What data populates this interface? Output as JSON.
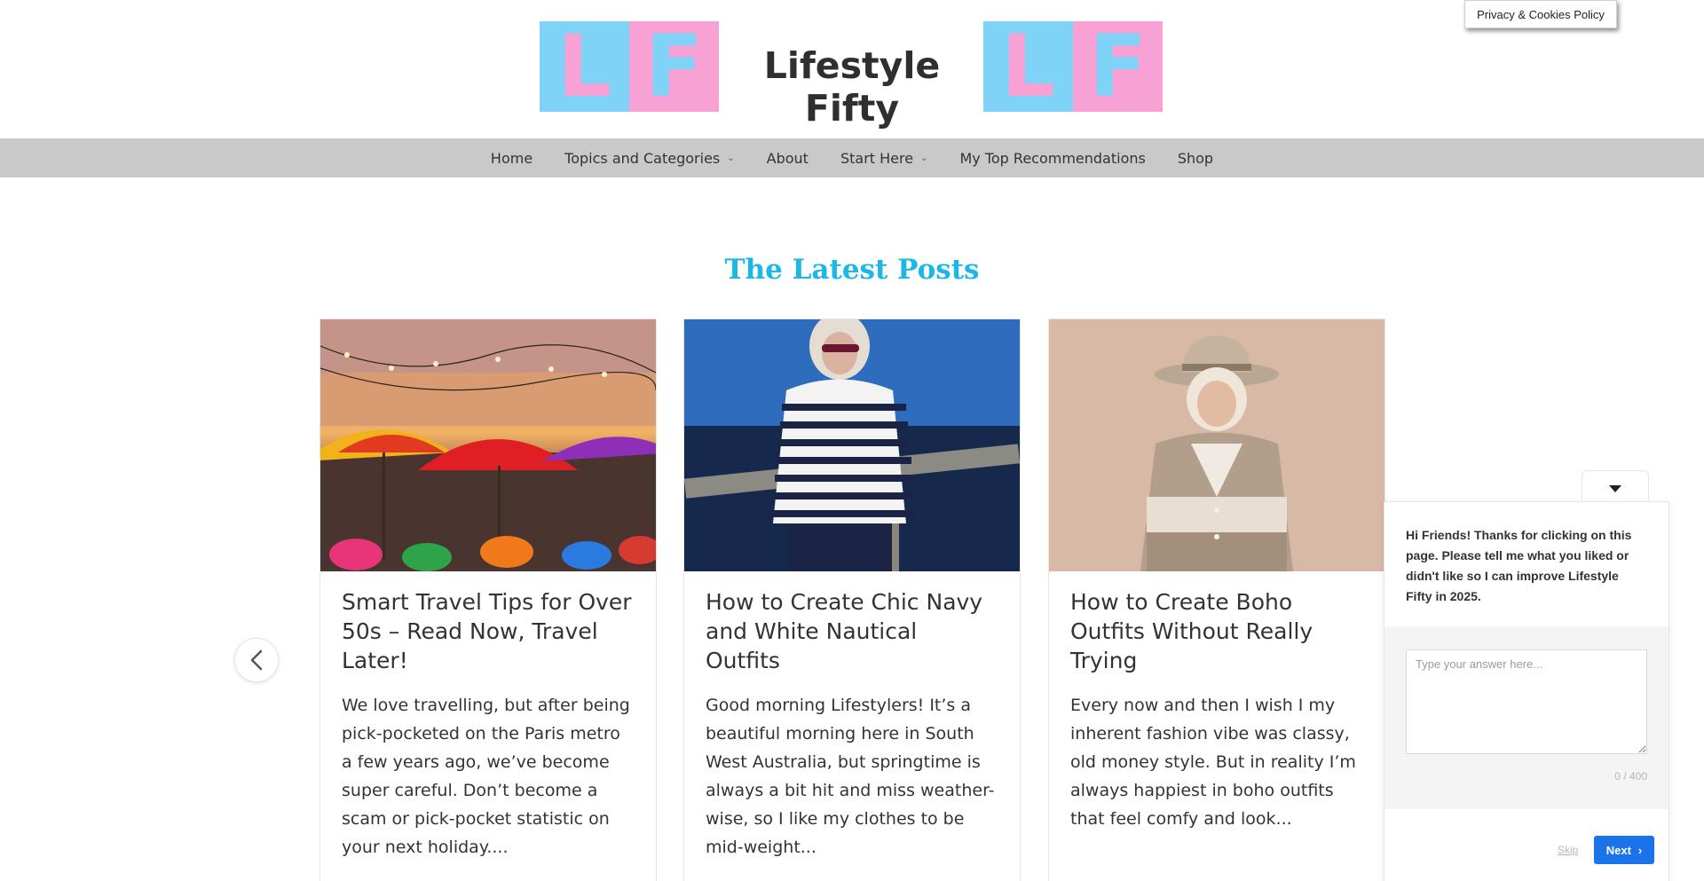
{
  "header": {
    "logo_letters": [
      "L",
      "F"
    ],
    "site_title": "Lifestyle Fifty",
    "privacy_button": "Privacy & Cookies Policy",
    "logo_colors": {
      "blue": "#7fd3f7",
      "pink": "#f7a1d4"
    }
  },
  "nav": {
    "items": [
      {
        "label": "Home",
        "has_dropdown": false
      },
      {
        "label": "Topics and Categories",
        "has_dropdown": true
      },
      {
        "label": "About",
        "has_dropdown": false
      },
      {
        "label": "Start Here",
        "has_dropdown": true
      },
      {
        "label": "My Top Recommendations",
        "has_dropdown": false
      },
      {
        "label": "Shop",
        "has_dropdown": false
      }
    ]
  },
  "section": {
    "title": "The Latest Posts",
    "title_color": "#1bb8e6"
  },
  "posts": [
    {
      "title": "Smart Travel Tips for Over 50s – Read Now, Travel Later!",
      "excerpt": "We love travelling, but after being pick-pocketed on the Paris metro a few years ago, we’ve become super careful. Don’t become a scam or pick-pocket statistic on your next holiday....",
      "image": "beach-umbrellas-sunset-photo"
    },
    {
      "title": "How to Create Chic Navy and White Nautical Outfits",
      "excerpt": "Good morning Lifestylers! It’s a beautiful morning here in South West Australia, but springtime is always a bit hit and miss weather-wise, so I like my clothes to be mid-weight...",
      "image": "woman-striped-sweater-lake-photo"
    },
    {
      "title": "How to Create Boho Outfits Without Really Trying",
      "excerpt": "Every now and then I wish I my inherent fashion vibe was classy, old money style. But in reality I’m always happiest in boho outfits that feel comfy and look...",
      "image": "woman-hat-cardigan-photo"
    }
  ],
  "survey": {
    "question": "Hi Friends! Thanks for clicking on this page. Please tell me what you liked or didn't like so I can improve Lifestyle Fifty in 2025.",
    "answer_placeholder": "Type your answer here...",
    "counter": "0 / 400",
    "skip_label": "Skip",
    "next_label": "Next",
    "accent_color": "#1a73e8"
  }
}
